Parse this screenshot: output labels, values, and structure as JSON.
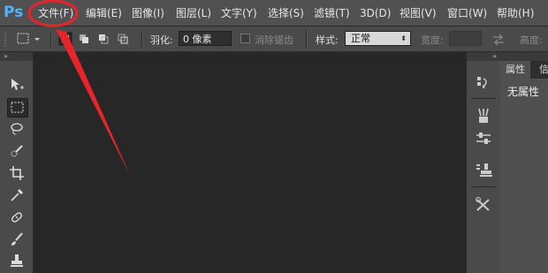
{
  "app": {
    "logo": "Ps",
    "accent_color": "#4fb3ff"
  },
  "menu": [
    "文件(F)",
    "编辑(E)",
    "图像(I)",
    "图层(L)",
    "文字(Y)",
    "选择(S)",
    "滤镜(T)",
    "3D(D)",
    "视图(V)",
    "窗口(W)",
    "帮助(H)"
  ],
  "options": {
    "feather_label": "羽化:",
    "feather_value": "0 像素",
    "antialias_label": "消除锯齿",
    "style_label": "样式:",
    "style_value": "正常",
    "width_label": "宽度:",
    "height_label": "高度:"
  },
  "panel": {
    "tabs": [
      "属性",
      "信"
    ],
    "no_properties": "无属性"
  },
  "annotation": {
    "color": "#e8242b"
  }
}
